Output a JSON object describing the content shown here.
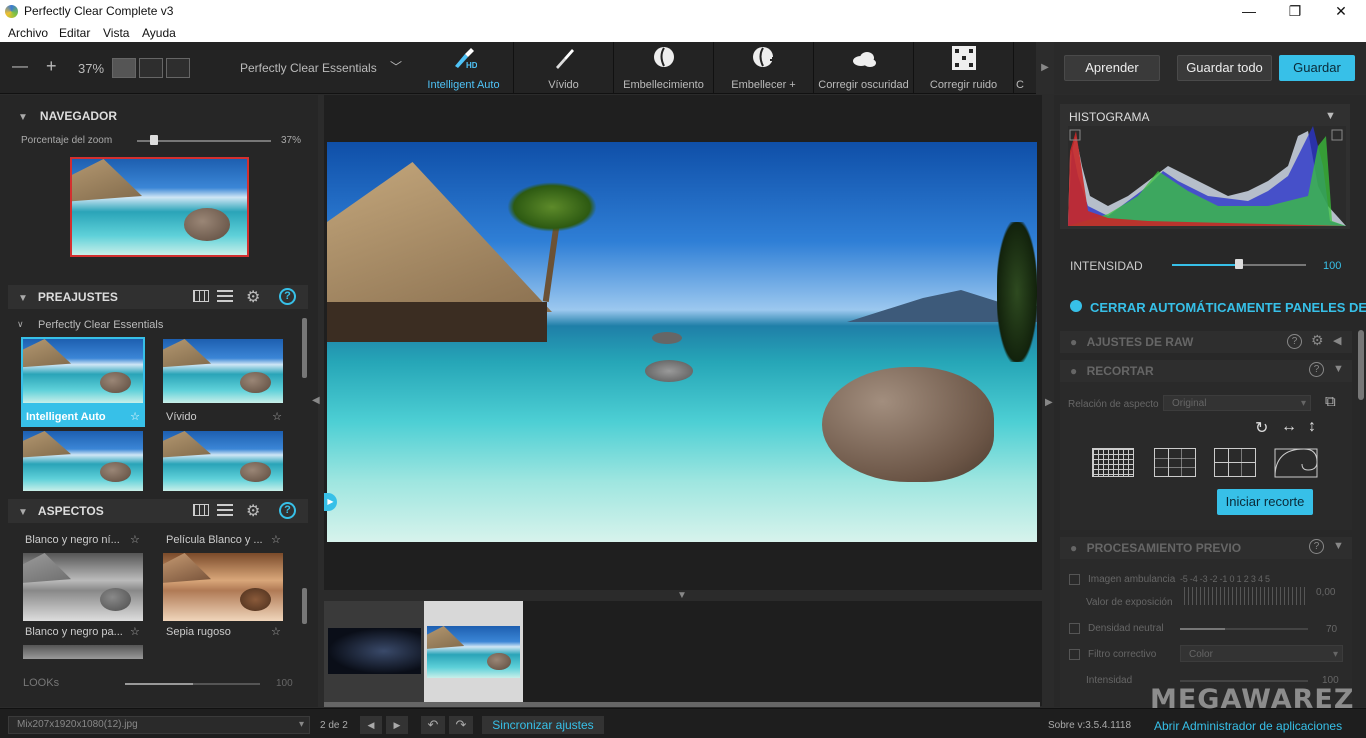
{
  "window": {
    "title": "Perfectly Clear Complete v3",
    "minimize": "—",
    "maximize": "❐",
    "close": "✕"
  },
  "menu": [
    "Archivo",
    "Editar",
    "Vista",
    "Ayuda"
  ],
  "toolbar": {
    "zoom_minus": "—",
    "zoom_plus": "+",
    "zoom_value": "37%",
    "preset_name": "Perfectly Clear Essentials",
    "tools": [
      {
        "label": "Intelligent Auto",
        "icon": "brush-hd-icon",
        "badge": "HD"
      },
      {
        "label": "Vívido",
        "icon": "brush-icon"
      },
      {
        "label": "Embellecimiento",
        "icon": "face-icon"
      },
      {
        "label": "Embellecer +",
        "icon": "face-plus-icon"
      },
      {
        "label": "Corregir oscuridad",
        "icon": "cloud-icon"
      },
      {
        "label": "Corregir ruido",
        "icon": "noise-icon"
      },
      {
        "label": "C",
        "icon": ""
      }
    ]
  },
  "navigator": {
    "title": "NAVEGADOR",
    "zoom_label": "Porcentaje del zoom",
    "zoom_value": "37%",
    "zoom_level": 0.1
  },
  "presets": {
    "title": "PREAJUSTES",
    "group": "Perfectly Clear Essentials",
    "items": [
      {
        "label": "Intelligent Auto",
        "selected": true
      },
      {
        "label": "Vívido",
        "selected": false
      },
      {
        "label": "",
        "selected": false
      },
      {
        "label": "",
        "selected": false
      }
    ]
  },
  "aspects": {
    "title": "ASPECTOS",
    "items": [
      {
        "label": "Blanco y negro ní..."
      },
      {
        "label": "Película Blanco y ..."
      },
      {
        "label": "Blanco y negro pa..."
      },
      {
        "label": "Sepia rugoso"
      }
    ],
    "looks_label": "LOOKs",
    "looks_value": "100",
    "looks_level": 0.5
  },
  "right": {
    "learn_btn": "Aprender",
    "save_all_btn": "Guardar todo",
    "save_btn": "Guardar",
    "histogram_title": "HISTOGRAMA",
    "intensity_label": "INTENSIDAD",
    "intensity_value": "100",
    "intensity_level": 0.5,
    "auto_close": "CERRAR AUTOMÁTICAMENTE PANELES DE AJ",
    "raw_title": "AJUSTES DE RAW",
    "crop_title": "RECORTAR",
    "aspect_label": "Relación de aspecto",
    "aspect_value": "Original",
    "start_crop": "Iniciar recorte",
    "preproc_title": "PROCESAMIENTO PREVIO",
    "ambient_label": "Imagen ambulancia",
    "ambient_scale": "-5 -4 -3 -2 -1 0 1 2 3 4 5",
    "exposure_label": "Valor de exposición",
    "exposure_value": "0,00",
    "density_label": "Densidad neutral",
    "density_value": "70",
    "density_level": 0.35,
    "filter_label": "Filtro correctivo",
    "filter_value": "Color",
    "intensity2_label": "Intensidad",
    "intensity2_value": "100"
  },
  "statusbar": {
    "filename": "Mix207x1920x1080(12).jpg",
    "counter": "2 de 2",
    "sync": "Sincronizar ajustes",
    "version": "Sobre v:3.5.4.1118",
    "admin": "Abrir Administrador de aplicaciones",
    "watermark": "MEGAWAREZ"
  }
}
